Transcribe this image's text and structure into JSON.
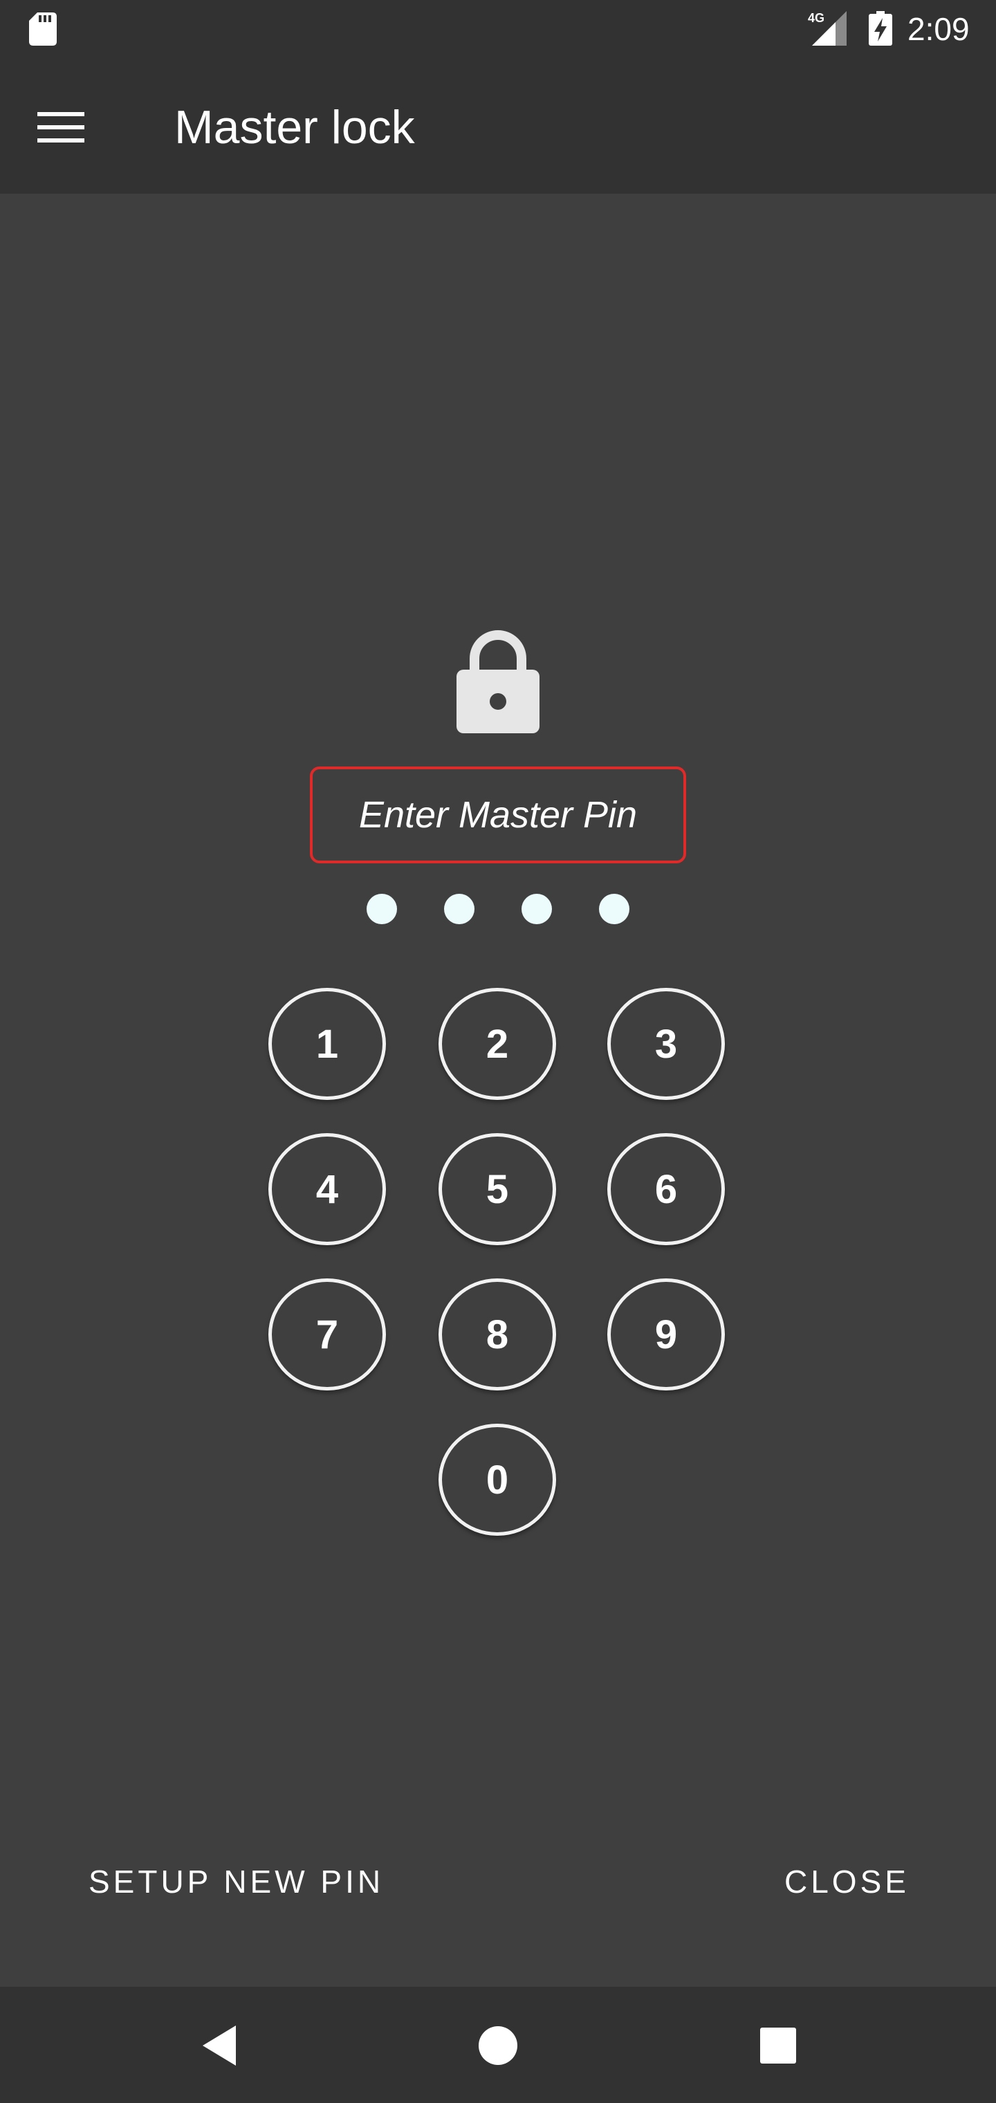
{
  "status_bar": {
    "time": "2:09",
    "network_label": "4G",
    "icons": [
      "sd-card-icon",
      "signal-4g-icon",
      "battery-charging-icon"
    ]
  },
  "app_bar": {
    "title": "Master lock",
    "menu_icon": "hamburger-menu-icon"
  },
  "lock": {
    "icon": "lock-icon",
    "prompt": "Enter Master Pin",
    "prompt_border_color": "#e02a2a",
    "pin_length": 4,
    "entered_digits": 0
  },
  "keypad": {
    "keys": [
      "1",
      "2",
      "3",
      "4",
      "5",
      "6",
      "7",
      "8",
      "9",
      "0"
    ]
  },
  "actions": {
    "setup_label": "SETUP NEW PIN",
    "close_label": "CLOSE"
  },
  "navigation": {
    "icons": [
      "back-icon",
      "home-icon",
      "recents-icon"
    ]
  },
  "colors": {
    "background": "#3f3f3f",
    "bars": "#323232",
    "accent_error": "#e02a2a",
    "dot": "#ecfbfb"
  }
}
